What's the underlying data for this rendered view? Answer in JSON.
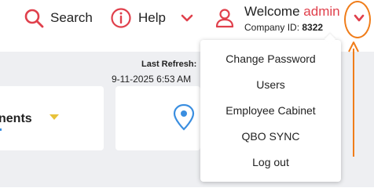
{
  "header": {
    "search_label": "Search",
    "help_label": "Help",
    "welcome_prefix": "Welcome",
    "username": "admin",
    "company_prefix": "Company ID:",
    "company_id": "8322"
  },
  "dashboard": {
    "last_refresh_label": "Last Refresh:",
    "last_refresh_value": "9-11-2025 6:53 AM",
    "card1_title": "nents"
  },
  "dropdown": {
    "items": [
      {
        "label": "Change Password"
      },
      {
        "label": "Users"
      },
      {
        "label": "Employee Cabinet"
      },
      {
        "label": "QBO SYNC"
      },
      {
        "label": "Log out"
      }
    ]
  },
  "colors": {
    "accent_red": "#e0404c",
    "annotation_orange": "#f07d1a",
    "caret_yellow": "#e7c23a",
    "pin_blue": "#3a8ee0",
    "content_gray": "#eeeff2"
  },
  "icons": [
    "search-icon",
    "info-icon",
    "chevron-down-icon",
    "user-icon",
    "map-pin-icon",
    "caret-down-icon"
  ]
}
